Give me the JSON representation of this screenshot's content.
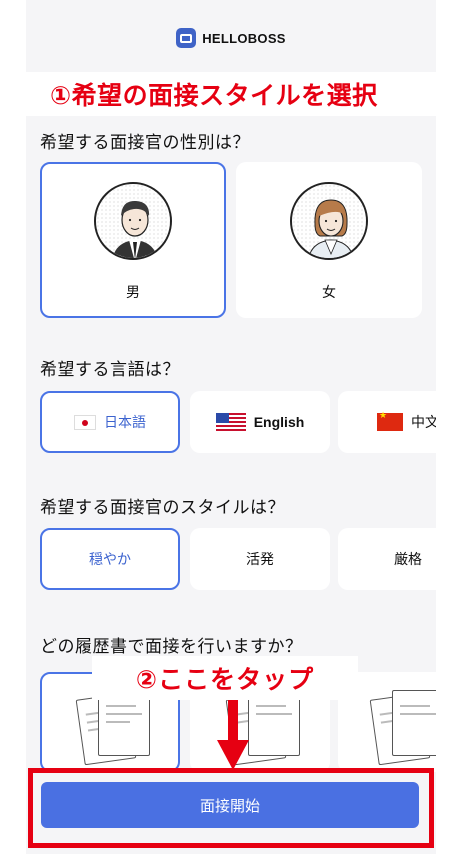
{
  "app": {
    "logo_text": "HELLOBOSS"
  },
  "annotations": {
    "step1": "①希望の面接スタイルを選択",
    "step2": "②ここをタップ"
  },
  "questions": {
    "gender": "希望する面接官の性別は？",
    "language": "希望する言語は？",
    "style": "希望する面接官のスタイルは？",
    "resume": "どの履歴書で面接を行いますか？"
  },
  "gender_options": [
    {
      "label": "男",
      "selected": true
    },
    {
      "label": "女",
      "selected": false
    }
  ],
  "language_options": [
    {
      "label": "日本語",
      "flag": "jp-flag-icon",
      "selected": true
    },
    {
      "label": "English",
      "flag": "us-flag-icon",
      "selected": false
    },
    {
      "label": "中文",
      "flag": "cn-flag-icon",
      "selected": false
    }
  ],
  "style_options": [
    {
      "label": "穏やか",
      "selected": true
    },
    {
      "label": "活発",
      "selected": false
    },
    {
      "label": "厳格",
      "selected": false
    }
  ],
  "cta": {
    "label": "面接開始"
  },
  "colors": {
    "accent": "#4a70e2",
    "annotation": "#e60012",
    "background": "#f5f5f7"
  }
}
